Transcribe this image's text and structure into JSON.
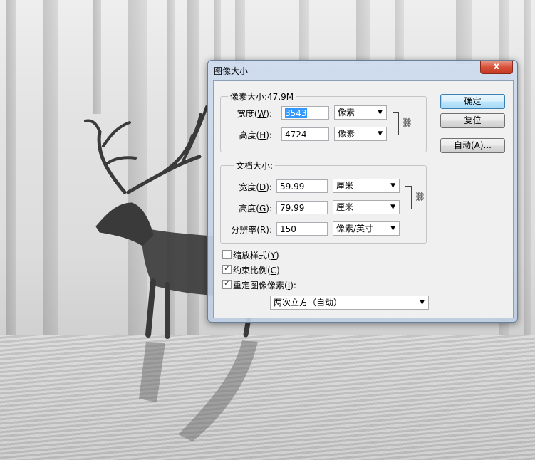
{
  "dialog": {
    "title": "图像大小",
    "close_label": "x",
    "pixel_dimensions": {
      "legend": "像素大小:47.9M",
      "width": {
        "label": "宽度",
        "key": "W",
        "value": "3543",
        "unit": "像素"
      },
      "height": {
        "label": "高度",
        "key": "H",
        "value": "4724",
        "unit": "像素"
      }
    },
    "document_size": {
      "legend": "文档大小:",
      "width": {
        "label": "宽度",
        "key": "D",
        "value": "59.99",
        "unit": "厘米"
      },
      "height": {
        "label": "高度",
        "key": "G",
        "value": "79.99",
        "unit": "厘米"
      },
      "resolution": {
        "label": "分辨率",
        "key": "R",
        "value": "150",
        "unit": "像素/英寸"
      }
    },
    "options": {
      "scale_styles": {
        "label": "缩放样式",
        "key": "Y",
        "checked": false
      },
      "constrain_proportions": {
        "label": "约束比例",
        "key": "C",
        "checked": true
      },
      "resample_image": {
        "label": "重定图像像素",
        "key": "I",
        "checked": true
      }
    },
    "resample_method": "两次立方（自动）",
    "buttons": {
      "ok": "确定",
      "reset": "复位",
      "auto": "自动(A)..."
    }
  },
  "icons": {
    "chain": "link-icon",
    "dropdown": "chevron-down-icon",
    "checkmark": "check-icon"
  },
  "colors": {
    "selection": "#3399ff",
    "close_button": "#c8472e",
    "default_button": "#3c7fb1"
  }
}
